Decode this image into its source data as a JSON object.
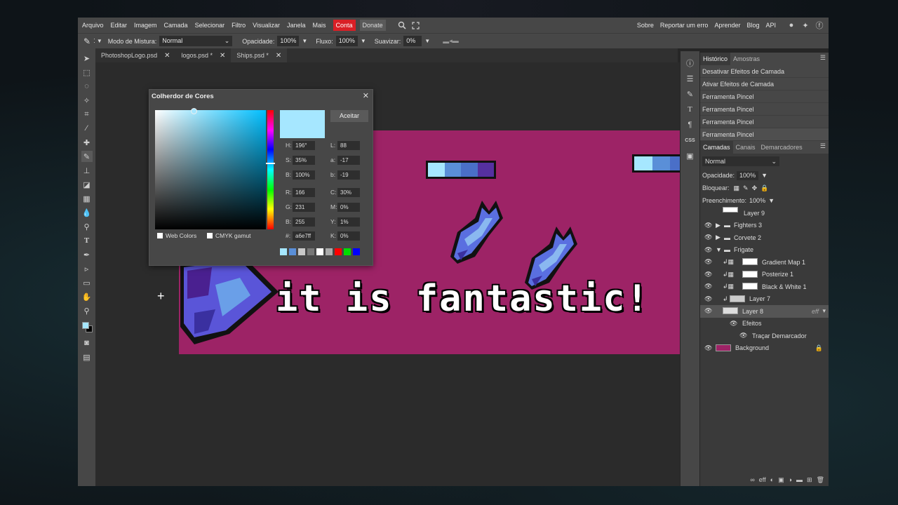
{
  "menubar": {
    "items": [
      "Arquivo",
      "Editar",
      "Imagem",
      "Camada",
      "Selecionar",
      "Filtro",
      "Visualizar",
      "Janela",
      "Mais"
    ],
    "conta": "Conta",
    "donate": "Donate",
    "right_items": [
      "Sobre",
      "Reportar um erro",
      "Aprender",
      "Blog",
      "API"
    ]
  },
  "optbar": {
    "blend_label": "Modo de Mistura:",
    "blend_value": "Normal",
    "opacity_label": "Opacidade:",
    "opacity_value": "100%",
    "flow_label": "Fluxo:",
    "flow_value": "100%",
    "smooth_label": "Suavizar:",
    "smooth_value": "0%"
  },
  "tabs": [
    {
      "label": "PhotoshopLogo.psd"
    },
    {
      "label": "logos.psd *"
    },
    {
      "label": "Ships.psd *"
    }
  ],
  "canvas": {
    "text": "it is fantastic!"
  },
  "picker": {
    "title": "Colherdor de Cores",
    "accept": "Aceitar",
    "H": "196°",
    "S": "35%",
    "B": "100%",
    "R": "166",
    "G": "231",
    "B2": "255",
    "hex": "a6e7ff",
    "L": "88",
    "a": "-17",
    "b": "-19",
    "C": "30%",
    "M": "0%",
    "Y": "1%",
    "K": "0%",
    "web_colors": "Web Colors",
    "cmyk_gamut": "CMYK gamut",
    "current_color": "#a6e7ff"
  },
  "history": {
    "tabs": [
      "Histórico",
      "Amostras"
    ],
    "items": [
      "Desativar Efeitos de Camada",
      "Ativar Efeitos de Camada",
      "Ferramenta Pincel",
      "Ferramenta Pincel",
      "Ferramenta Pincel",
      "Ferramenta Pincel"
    ]
  },
  "layers": {
    "tabs": [
      "Camadas",
      "Canais",
      "Demarcadores"
    ],
    "blend": "Normal",
    "opacity_label": "Opacidade:",
    "opacity_value": "100%",
    "lock_label": "Bloquear:",
    "fill_label": "Preenchimento:",
    "fill_value": "100%",
    "list": [
      {
        "name": "Layer 9"
      },
      {
        "name": "Fighters 3"
      },
      {
        "name": "Corvete 2"
      },
      {
        "name": "Frigate"
      },
      {
        "name": "Gradient Map 1"
      },
      {
        "name": "Posterize 1"
      },
      {
        "name": "Black & White 1"
      },
      {
        "name": "Layer 7"
      },
      {
        "name": "Layer 8"
      },
      {
        "name": "Efeitos"
      },
      {
        "name": "Traçar Demarcador"
      },
      {
        "name": "Background"
      }
    ],
    "fx_badge": "eff"
  },
  "colors": {
    "accent_red": "#d91f26",
    "canvas_bg": "#9d2366"
  }
}
